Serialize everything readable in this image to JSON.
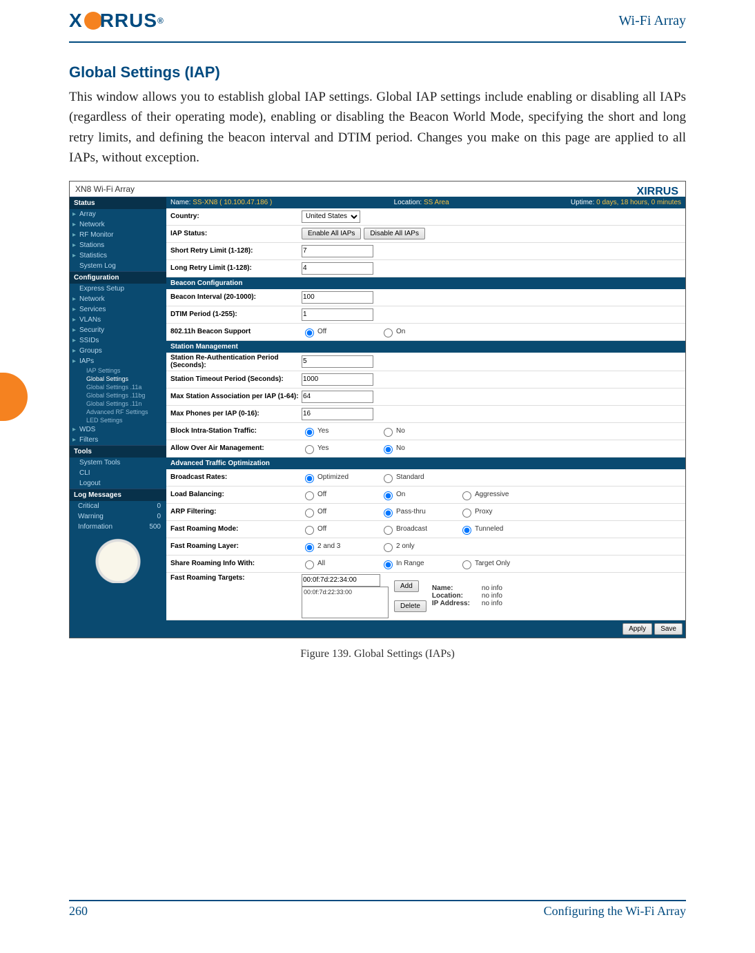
{
  "header": {
    "brand": "XIRRUS",
    "product": "Wi-Fi Array"
  },
  "title": "Global Settings (IAP)",
  "paragraph": "This window allows you to establish global IAP settings. Global IAP settings include enabling or disabling all IAPs (regardless of their operating mode), enabling or disabling the Beacon World Mode, specifying the short and long retry limits, and defining the beacon interval and DTIM period. Changes you make on this page are applied to all IAPs, without exception.",
  "caption": "Figure 139. Global Settings (IAPs)",
  "footer": {
    "page": "260",
    "section": "Configuring the Wi-Fi Array"
  },
  "ss": {
    "title": "XN8 Wi-Fi Array",
    "logo": "XIRRUS",
    "topbar": {
      "name_lbl": "Name:",
      "name": "SS-XN8   ( 10.100.47.186 )",
      "loc_lbl": "Location:",
      "loc": "SS Area",
      "up_lbl": "Uptime:",
      "up": "0 days, 18 hours, 0 minutes"
    },
    "sidebar": {
      "status_h": "Status",
      "status": [
        "Array",
        "Network",
        "RF Monitor",
        "Stations",
        "Statistics",
        "System Log"
      ],
      "config_h": "Configuration",
      "config": [
        "Express Setup",
        "Network",
        "Services",
        "VLANs",
        "Security",
        "SSIDs",
        "Groups",
        "IAPs"
      ],
      "iap_sub": [
        "IAP Settings",
        "Global Settings",
        "Global Settings .11a",
        "Global Settings .11bg",
        "Global Settings .11n",
        "Advanced RF Settings",
        "LED Settings"
      ],
      "config2": [
        "WDS",
        "Filters"
      ],
      "tools_h": "Tools",
      "tools": [
        "System Tools",
        "CLI",
        "Logout"
      ],
      "log_h": "Log Messages",
      "log": [
        [
          "Critical",
          "0"
        ],
        [
          "Warning",
          "0"
        ],
        [
          "Information",
          "500"
        ]
      ]
    },
    "form": {
      "country_l": "Country:",
      "country": "United States",
      "iap_l": "IAP Status:",
      "iap_en": "Enable All IAPs",
      "iap_dis": "Disable All IAPs",
      "srl_l": "Short Retry Limit (1-128):",
      "srl": "7",
      "lrl_l": "Long Retry Limit (1-128):",
      "lrl": "4",
      "sect_bc": "Beacon Configuration",
      "bi_l": "Beacon Interval (20-1000):",
      "bi": "100",
      "dt_l": "DTIM Period (1-255):",
      "dt": "1",
      "bs_l": "802.11h Beacon Support",
      "bs_off": "Off",
      "bs_on": "On",
      "sect_sm": "Station Management",
      "ra_l": "Station Re-Authentication Period (Seconds):",
      "ra": "5",
      "to_l": "Station Timeout Period (Seconds):",
      "to": "1000",
      "mx_l": "Max Station Association per IAP (1-64):",
      "mx": "64",
      "mp_l": "Max Phones per IAP (0-16):",
      "mp": "16",
      "bt_l": "Block Intra-Station Traffic:",
      "bt_y": "Yes",
      "bt_n": "No",
      "oa_l": "Allow Over Air Management:",
      "oa_y": "Yes",
      "oa_n": "No",
      "sect_at": "Advanced Traffic Optimization",
      "br_l": "Broadcast Rates:",
      "br_o": "Optimized",
      "br_s": "Standard",
      "lb_l": "Load Balancing:",
      "lb_off": "Off",
      "lb_on": "On",
      "lb_ag": "Aggressive",
      "ar_l": "ARP Filtering:",
      "ar_off": "Off",
      "ar_pt": "Pass-thru",
      "ar_px": "Proxy",
      "fm_l": "Fast Roaming Mode:",
      "fm_off": "Off",
      "fm_bc": "Broadcast",
      "fm_tn": "Tunneled",
      "fl_l": "Fast Roaming Layer:",
      "fl_23": "2 and 3",
      "fl_2": "2 only",
      "sr_l": "Share Roaming Info With:",
      "sr_all": "All",
      "sr_ir": "In Range",
      "sr_to": "Target Only",
      "ft_l": "Fast Roaming Targets:",
      "ft_input": "00:0f:7d:22:34:00",
      "ft_list": "00:0f:7d:22:33:00",
      "ft_add": "Add",
      "ft_del": "Delete",
      "ft_name_l": "Name:",
      "ft_name": "no info",
      "ft_loc_l": "Location:",
      "ft_loc": "no info",
      "ft_ip_l": "IP Address:",
      "ft_ip": "no info",
      "apply": "Apply",
      "save": "Save"
    }
  }
}
